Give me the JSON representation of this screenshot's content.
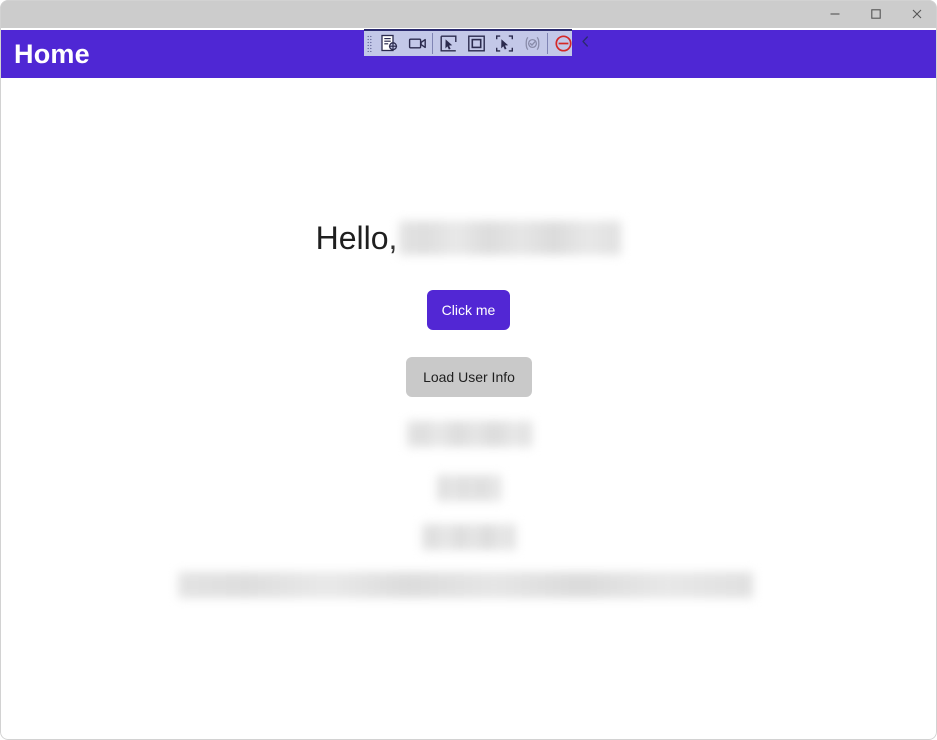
{
  "window": {
    "controls": [
      {
        "name": "minimize",
        "label": "Minimize",
        "glyph": "minimize-icon"
      },
      {
        "name": "maximize",
        "label": "Maximize",
        "glyph": "maximize-icon"
      },
      {
        "name": "close",
        "label": "Close",
        "glyph": "close-icon"
      }
    ]
  },
  "automation_toolbar": {
    "grip_label": "Drag handle",
    "buttons": [
      {
        "name": "inspect-element",
        "icon": "inspect-document-icon",
        "enabled": true
      },
      {
        "name": "record-video",
        "icon": "video-camera-icon",
        "enabled": true
      },
      {
        "name": "select-element",
        "icon": "cursor-select-icon",
        "enabled": true
      },
      {
        "name": "highlight-element",
        "icon": "bounding-box-icon",
        "enabled": true
      },
      {
        "name": "select-region",
        "icon": "cursor-region-icon",
        "enabled": true
      },
      {
        "name": "validate",
        "icon": "validate-check-icon",
        "enabled": false
      },
      {
        "name": "stop",
        "icon": "stop-block-icon",
        "enabled": true
      }
    ],
    "collapse_icon": "chevron-left-icon"
  },
  "header": {
    "title": "Home"
  },
  "main": {
    "greeting_prefix": "Hello,",
    "greeting_name_redacted": true,
    "click_me_label": "Click me",
    "load_user_info_label": "Load User Info",
    "redacted_blocks": [
      {
        "name": "user-line-1",
        "redacted": true
      },
      {
        "name": "user-line-2",
        "redacted": true
      },
      {
        "name": "user-line-3",
        "redacted": true
      },
      {
        "name": "footer-bar",
        "redacted": true
      }
    ]
  },
  "colors": {
    "brand_purple": "#4f27d4",
    "button_purple": "#5227d4",
    "titlebar_gray": "#cccccc",
    "toolbar_lavender": "#c3c8e8",
    "toolbar_border": "#2b2b6e",
    "secondary_button_gray": "#c9c9c9",
    "stop_red": "#d42727",
    "content_background": "#ffffff"
  }
}
